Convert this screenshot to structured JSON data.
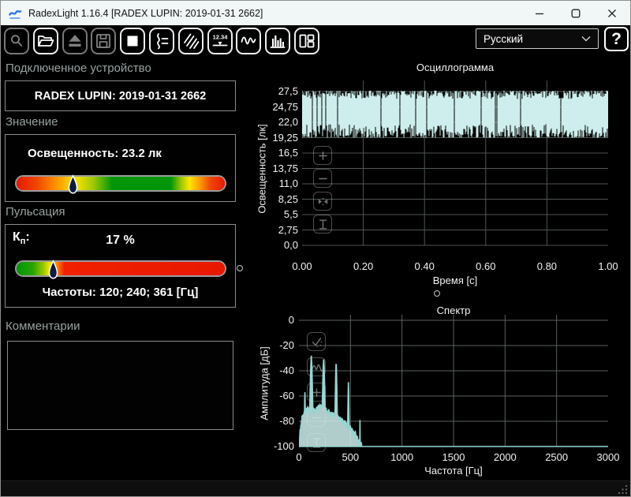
{
  "titlebar": {
    "title": "RadexLight 1.16.4 [RADEX LUPIN: 2019-01-31 2662]"
  },
  "toolbar": {
    "buttons": [
      {
        "name": "preview",
        "icon": "magnifier-doc-icon",
        "enabled": false
      },
      {
        "name": "open-file",
        "icon": "open-folder-icon",
        "enabled": true
      },
      {
        "name": "eject-device",
        "icon": "eject-icon",
        "enabled": false
      },
      {
        "name": "save-file",
        "icon": "floppy-icon",
        "enabled": false
      },
      {
        "name": "stop-measurement",
        "icon": "stop-square-icon",
        "enabled": true
      },
      {
        "name": "signal-settings",
        "icon": "signal-settings-icon",
        "enabled": true
      },
      {
        "name": "hatch-mode",
        "icon": "hatch-icon",
        "enabled": true
      },
      {
        "name": "numeric-display",
        "icon": "numeric-display-icon",
        "enabled": true,
        "text": "12.34"
      },
      {
        "name": "oscillogram-view",
        "icon": "wave-icon",
        "enabled": true
      },
      {
        "name": "spectrum-view",
        "icon": "bar-chart-icon",
        "enabled": true
      },
      {
        "name": "layout-view",
        "icon": "layout-icon",
        "enabled": true
      }
    ],
    "language_select": {
      "value": "Русский"
    },
    "help_label": "?"
  },
  "panels": {
    "device": {
      "header": "Подключенное устройство",
      "value": "RADEX LUPIN: 2019-01-31 2662"
    },
    "value": {
      "header": "Значение",
      "reading": "Освещенность: 23.2 лк",
      "marker_percent": 27,
      "gradient": [
        "#e81800 0%",
        "#f04800 10%",
        "#ff9c00 20%",
        "#ffe600 28%",
        "#9cc800 37%",
        "#009608 46%",
        "#009608 74%",
        "#9cc800 79%",
        "#ffe600 83%",
        "#ff9c00 88%",
        "#f04800 93%",
        "#e81800 100%"
      ]
    },
    "pulsation": {
      "header": "Пульсация",
      "kp_main": "К",
      "kp_sub": "п",
      "kp_colon": ":",
      "value": "17 %",
      "marker_percent": 17.5,
      "gradient": [
        "#009608 0%",
        "#2ca400 8%",
        "#9cc800 13%",
        "#ffe600 16%",
        "#ff9000 19%",
        "#f02000 23%",
        "#e81800 100%"
      ],
      "frequencies": "Частоты: 120; 240; 361 [Гц]"
    },
    "comments": {
      "header": "Комментарии",
      "value": ""
    }
  },
  "chart_data": [
    {
      "id": "oscillogram",
      "type": "line",
      "title": "Осциллограмма",
      "xlabel": "Время [с]",
      "ylabel": "Освещенность [лк]",
      "xlim": [
        0,
        1
      ],
      "ylim": [
        0,
        27.5
      ],
      "grid": true,
      "xticks": [
        {
          "v": 0.0,
          "label": "0.00"
        },
        {
          "v": 0.2,
          "label": "0.20"
        },
        {
          "v": 0.4,
          "label": "0.40"
        },
        {
          "v": 0.6,
          "label": "0.60"
        },
        {
          "v": 0.8,
          "label": "0.80"
        },
        {
          "v": 1.0,
          "label": "1.00"
        }
      ],
      "yticks": [
        {
          "v": 0,
          "label": "0,0"
        },
        {
          "v": 2.75,
          "label": "2,75"
        },
        {
          "v": 5.5,
          "label": "5,5"
        },
        {
          "v": 8.25,
          "label": "8,25"
        },
        {
          "v": 11,
          "label": "11,0"
        },
        {
          "v": 13.75,
          "label": "13,75"
        },
        {
          "v": 16.5,
          "label": "16,5"
        },
        {
          "v": 19.25,
          "label": "19,25"
        },
        {
          "v": 22,
          "label": "22,0"
        },
        {
          "v": 24.75,
          "label": "24,75"
        },
        {
          "v": 27.5,
          "label": "27,5"
        }
      ],
      "signal": {
        "shape": "lamp-flicker-band",
        "freq_hz": 120,
        "band_min_lux": 19.3,
        "band_max_lux": 27.6,
        "mean_lux": 23.2
      },
      "color": "#cdeeec",
      "grid_color": "#4f5555"
    },
    {
      "id": "spectrum",
      "type": "area",
      "title": "Спектр",
      "xlabel": "Частота [Гц]",
      "ylabel": "Амплитуда [дБ]",
      "xlim": [
        0,
        3000
      ],
      "ylim": [
        -100,
        0
      ],
      "grid": true,
      "xticks": [
        {
          "v": 0,
          "label": "0"
        },
        {
          "v": 500,
          "label": "500"
        },
        {
          "v": 1000,
          "label": "1000"
        },
        {
          "v": 1500,
          "label": "1500"
        },
        {
          "v": 2000,
          "label": "2000"
        },
        {
          "v": 2500,
          "label": "2500"
        },
        {
          "v": 3000,
          "label": "3000"
        }
      ],
      "yticks": [
        {
          "v": 0,
          "label": "0"
        },
        {
          "v": -20,
          "label": "-20"
        },
        {
          "v": -40,
          "label": "-40"
        },
        {
          "v": -60,
          "label": "-60"
        },
        {
          "v": -80,
          "label": "-80"
        },
        {
          "v": -100,
          "label": "-100"
        }
      ],
      "peaks": [
        {
          "hz": 58,
          "db": -57,
          "w": 4
        },
        {
          "hz": 120,
          "db": -28,
          "w": 8
        },
        {
          "hz": 240,
          "db": -31,
          "w": 8
        },
        {
          "hz": 361,
          "db": -34,
          "w": 6
        },
        {
          "hz": 480,
          "db": -49,
          "w": 4
        },
        {
          "hz": 592,
          "db": -79,
          "w": 2
        }
      ],
      "noise_floor": [
        [
          0,
          -100
        ],
        [
          12,
          -88
        ],
        [
          28,
          -78
        ],
        [
          55,
          -73
        ],
        [
          95,
          -70
        ],
        [
          150,
          -72
        ],
        [
          205,
          -68
        ],
        [
          255,
          -71
        ],
        [
          310,
          -74
        ],
        [
          370,
          -77
        ],
        [
          430,
          -80
        ],
        [
          490,
          -85
        ],
        [
          540,
          -90
        ],
        [
          580,
          -95
        ],
        [
          612,
          -100
        ],
        [
          3000,
          -100
        ]
      ],
      "color": "#cdeeec",
      "line_color": "#93d6d2",
      "grid_color": "#5a6060"
    }
  ]
}
